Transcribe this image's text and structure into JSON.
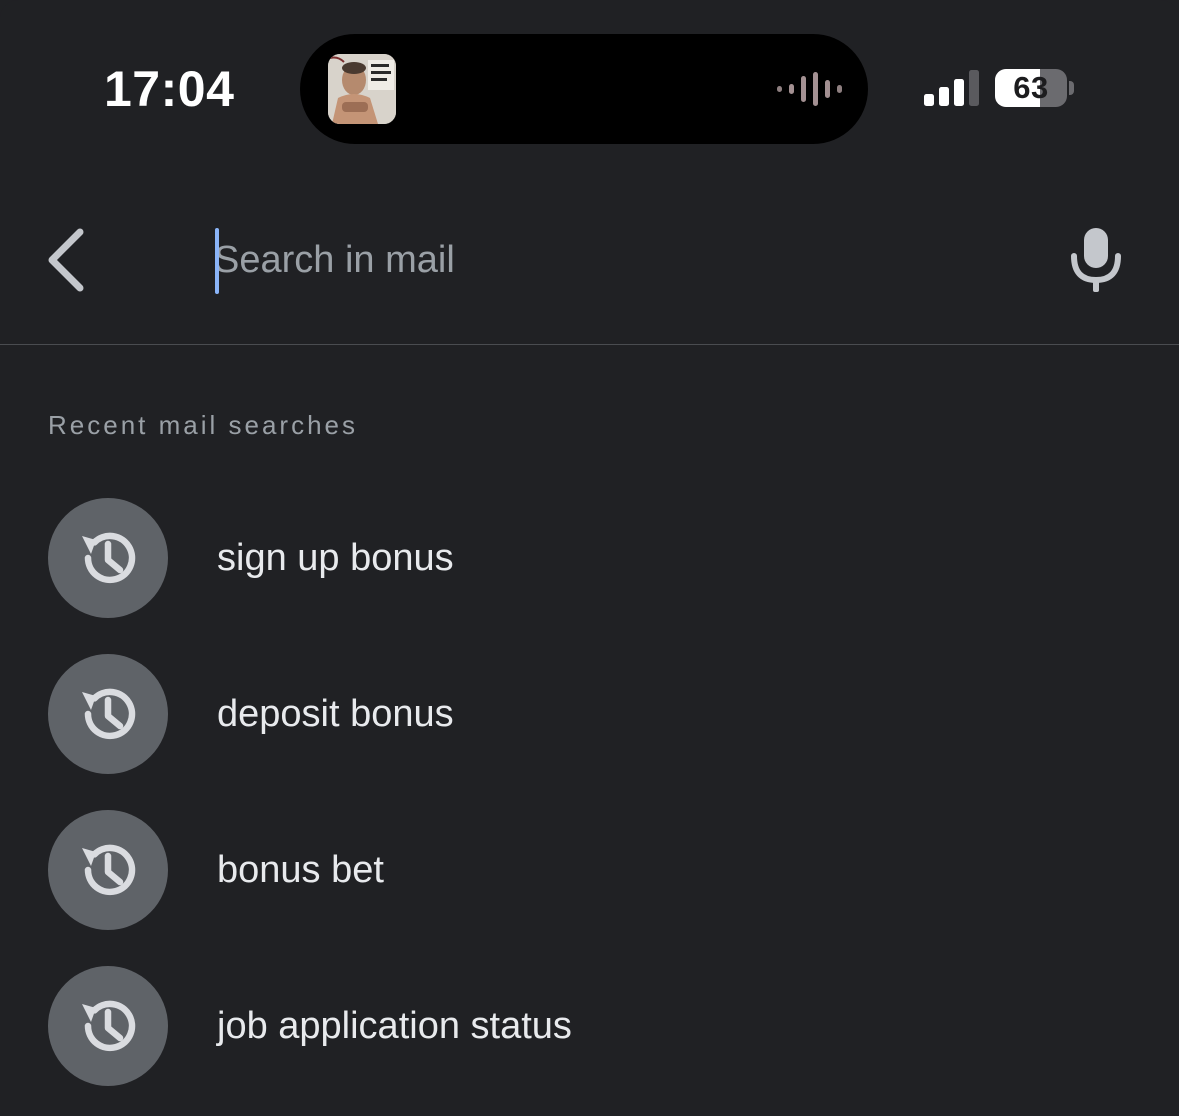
{
  "status_bar": {
    "time": "17:04",
    "battery_level": "63",
    "signal_bars_active": 3,
    "signal_bars_total": 4
  },
  "search": {
    "placeholder": "Search in mail",
    "value": ""
  },
  "recent": {
    "heading": "Recent mail searches",
    "items": [
      {
        "label": "sign up bonus"
      },
      {
        "label": "deposit bonus"
      },
      {
        "label": "bonus bet"
      },
      {
        "label": "job application status"
      }
    ]
  },
  "icons": {
    "back": "chevron-left-icon",
    "mic": "microphone-icon",
    "history": "history-clock-icon",
    "audio": "audio-waveform-icon"
  },
  "colors": {
    "background": "#202124",
    "accent": "#8ab4f8",
    "icon_circle": "#5f6368",
    "icon_glyph": "#dadce0",
    "text_primary": "#e8eaed",
    "text_secondary": "#9aa0a6"
  }
}
